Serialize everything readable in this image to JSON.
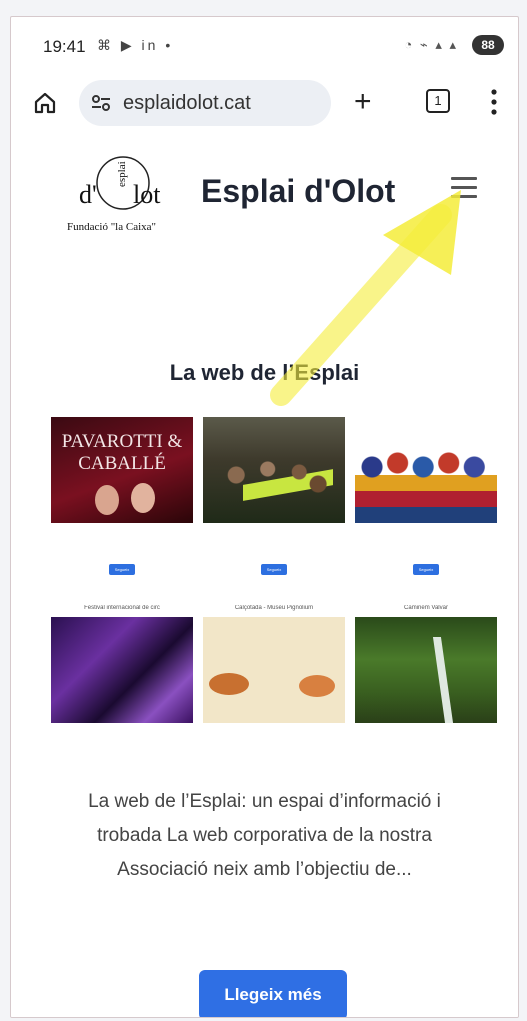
{
  "status_bar": {
    "time": "19:41",
    "notifications": "⌘ ▶ in •",
    "network": "◔ ⌁ ▴ ▴",
    "battery": "88"
  },
  "browser": {
    "url": "esplaidolot.cat",
    "tab_count": "1"
  },
  "site": {
    "logo_text": "d'esplai olot",
    "logo_caption": "Fundació \"la Caixa\"",
    "title": "Esplai d'Olot"
  },
  "section": {
    "title": "La web de l’Esplai"
  },
  "cards": [
    {
      "heading": "",
      "thumb_text": "PAVAROTTI & CABALLÉ",
      "excerpt": "",
      "button": "Segueix llegint"
    },
    {
      "heading": "",
      "thumb_text": "",
      "excerpt": "",
      "button": "Segueix llegint"
    },
    {
      "heading": "",
      "thumb_text": "",
      "excerpt": "",
      "button": "Segueix llegint"
    },
    {
      "heading": "Festival internacional de circ",
      "thumb_text": "",
      "excerpt": "",
      "button": ""
    },
    {
      "heading": "Calçotada - Museu Pignolium",
      "thumb_text": "",
      "excerpt": "",
      "button": ""
    },
    {
      "heading": "Caminem Valvar",
      "thumb_text": "",
      "excerpt": "",
      "button": ""
    }
  ],
  "summary": {
    "text": "La web de l’Esplai: un espai d’informació i trobada La web corporativa de la nostra Associació neix amb l’objectiu de..."
  },
  "cta": {
    "label": "Llegeix més"
  },
  "colors": {
    "accent": "#2f6fe4",
    "title": "#1f2533",
    "highlight_arrow": "#f5ec3a"
  }
}
